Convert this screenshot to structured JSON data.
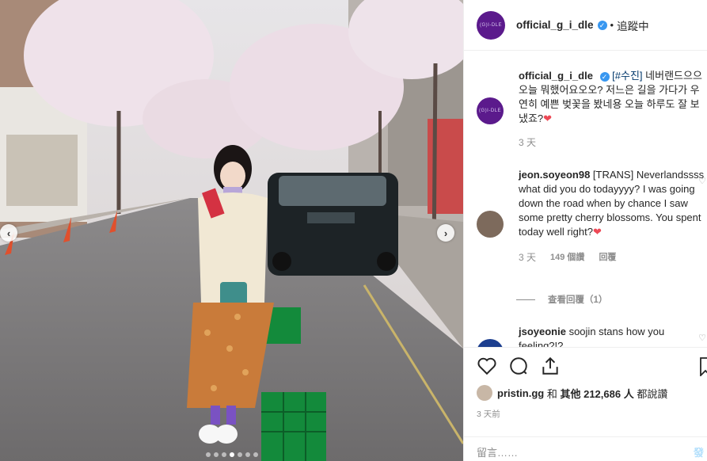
{
  "post": {
    "username": "official_g_i_dle",
    "follow_status": "追蹤中",
    "brand_avatar_text": "(G)I-DLE",
    "verified_mark": "✓",
    "separator": "•",
    "image_dots": 7,
    "active_dot": 3
  },
  "comments": [
    {
      "username": "official_g_i_dle",
      "hashtag": "[#수진]",
      "text": " 네버랜드으으 오늘 뭐했어요오오? 저느은 길을 가다가 우연히 예쁜 벚꽃을 봤네용 오늘 하루도 잘 보냈죠?",
      "emoji": "❤",
      "time": "3 天"
    },
    {
      "username": "jeon.soyeon98",
      "text": " [TRANS] Neverlandssss what did you do todayyyy? I was going down the road when by chance I saw some pretty cherry blossoms. You spent today well right?",
      "emoji": "❤",
      "time": "3 天",
      "likes": "149 個讚",
      "reply": "回覆",
      "view_replies": "查看回覆（1）"
    },
    {
      "username": "jsoyeonie",
      "text": " soojin stans how you feeling?!?"
    }
  ],
  "actions": {
    "liked_by_user": "pristin.gg",
    "liked_by_sep": "和",
    "liked_by_others": "其他 212,686 人",
    "liked_suffix": "都說讚",
    "timestamp": "3 天前",
    "comment_placeholder": "留言……",
    "post_label": "發佈"
  },
  "nav": {
    "prev": "‹",
    "next": "›"
  },
  "colors": {
    "brand_avatar": "#5b1a8c",
    "verified": "#3897f0",
    "heart": "#ed4956"
  }
}
